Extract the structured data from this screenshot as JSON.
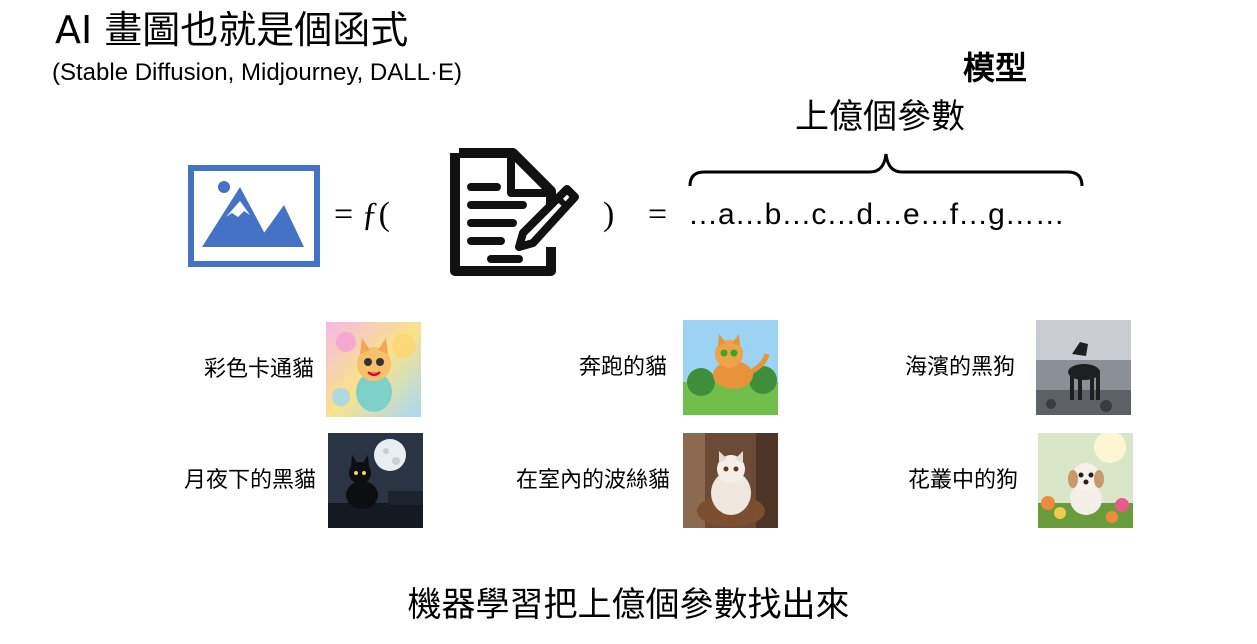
{
  "title": "AI 畫圖也就是個函式",
  "subtitle": "(Stable Diffusion, Midjourney, DALL·E)",
  "model_label": "模型",
  "params_label": "上億個參數",
  "equation": {
    "equals_f": "= ƒ(",
    "close_paren": ")",
    "equals": "=",
    "params_sequence": "…a…b…c…d…e…f…g……"
  },
  "examples": [
    {
      "caption": "彩色卡通貓"
    },
    {
      "caption": "奔跑的貓"
    },
    {
      "caption": "海濱的黑狗"
    },
    {
      "caption": "月夜下的黑貓"
    },
    {
      "caption": "在室內的波絲貓"
    },
    {
      "caption": "花叢中的狗"
    }
  ],
  "bottom_text": "機器學習把上億個參數找出來",
  "colors": {
    "image_icon_blue": "#4472C4"
  }
}
